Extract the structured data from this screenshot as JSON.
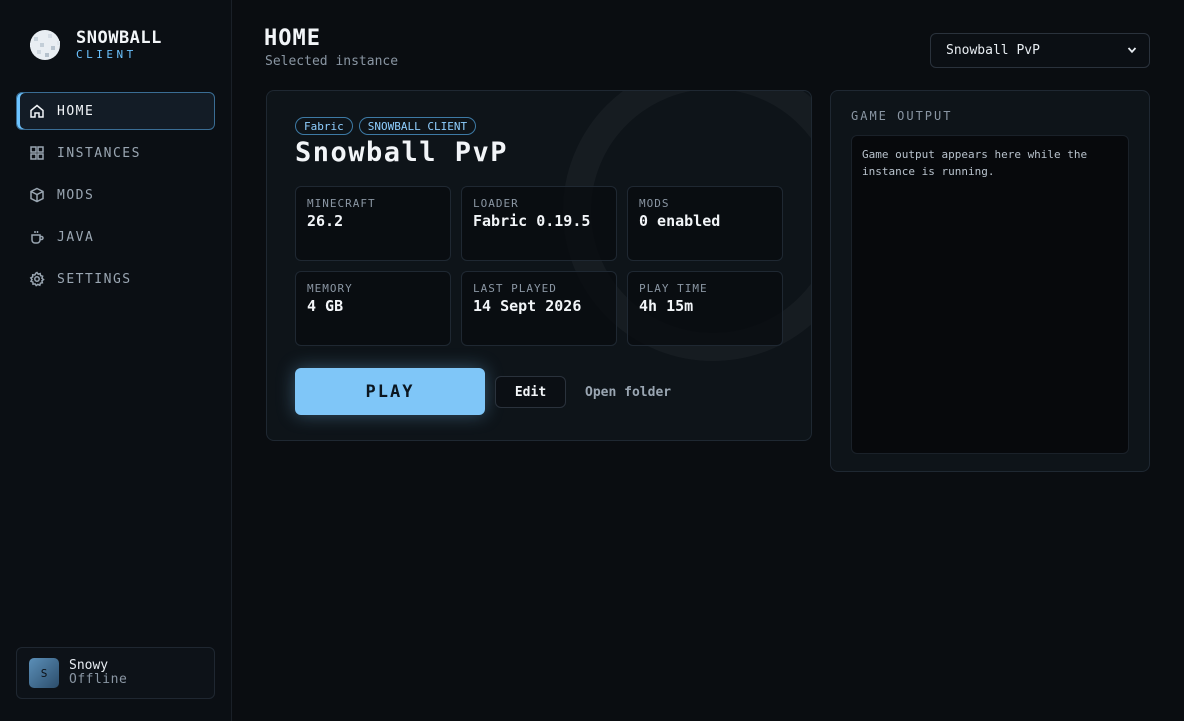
{
  "brand": {
    "name": "SNOWBALL",
    "sub": "CLIENT"
  },
  "nav": [
    {
      "label": "HOME",
      "icon": "home-icon",
      "active": true
    },
    {
      "label": "INSTANCES",
      "icon": "grid-icon",
      "active": false
    },
    {
      "label": "MODS",
      "icon": "cube-icon",
      "active": false
    },
    {
      "label": "JAVA",
      "icon": "cup-icon",
      "active": false
    },
    {
      "label": "SETTINGS",
      "icon": "gear-icon",
      "active": false
    }
  ],
  "user": {
    "initial": "S",
    "name": "Snowy",
    "status": "Offline"
  },
  "header": {
    "title": "HOME",
    "subtitle": "Selected instance",
    "selected_instance": "Snowball PvP"
  },
  "instance": {
    "tags": [
      "Fabric",
      "SNOWBALL CLIENT"
    ],
    "name": "Snowball PvP",
    "stats": [
      {
        "label": "MINECRAFT",
        "value": "26.2"
      },
      {
        "label": "LOADER",
        "value": "Fabric 0.19.5"
      },
      {
        "label": "MODS",
        "value": "0 enabled"
      },
      {
        "label": "MEMORY",
        "value": "4 GB"
      },
      {
        "label": "LAST PLAYED",
        "value": "14 Sept 2026"
      },
      {
        "label": "PLAY TIME",
        "value": "4h 15m"
      }
    ],
    "actions": {
      "play": "PLAY",
      "edit": "Edit",
      "open_folder": "Open folder"
    }
  },
  "output": {
    "title": "GAME OUTPUT",
    "placeholder": "Game output appears here while the instance is running."
  },
  "colors": {
    "accent": "#7fc6f8",
    "background": "#0a0d11",
    "panel": "#0e1419"
  }
}
